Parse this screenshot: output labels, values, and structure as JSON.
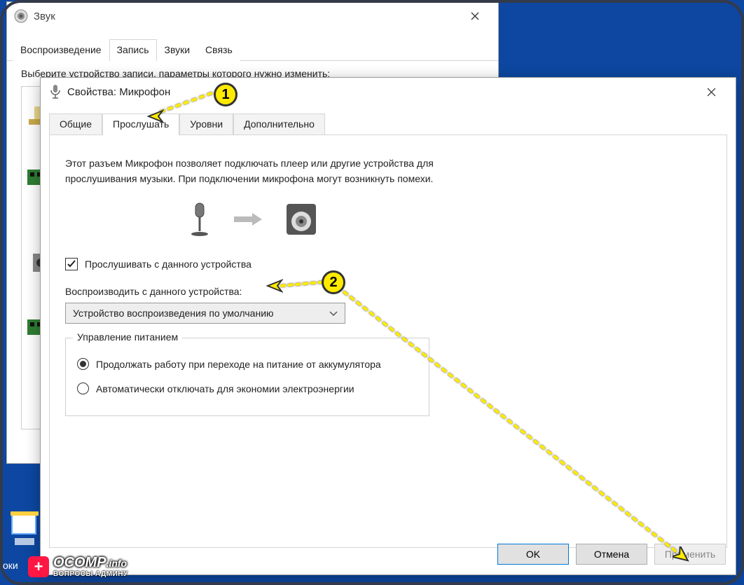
{
  "sound_window": {
    "title": "Звук",
    "tabs": [
      "Воспроизведение",
      "Запись",
      "Звуки",
      "Связь"
    ],
    "active_tab_index": 1,
    "instruction": "Выберите устройство записи, параметры которого нужно изменить:"
  },
  "prop_window": {
    "title": "Свойства: Микрофон",
    "tabs": [
      "Общие",
      "Прослушать",
      "Уровни",
      "Дополнительно"
    ],
    "active_tab_index": 1,
    "description": "Этот разъем Микрофон позволяет подключать плеер или другие устройства для прослушивания музыки. При подключении микрофона могут возникнуть помехи.",
    "checkbox_label": "Прослушивать с данного устройства",
    "checkbox_checked": true,
    "playback_label": "Воспроизводить с данного устройства:",
    "playback_value": "Устройство воспроизведения по умолчанию",
    "power_group_title": "Управление питанием",
    "radio1": "Продолжать работу при переходе на питание от аккумулятора",
    "radio2": "Автоматически отключать для экономии электроэнергии",
    "radio_selected": 0,
    "buttons": {
      "ok": "OK",
      "cancel": "Отмена",
      "apply": "Применить"
    }
  },
  "markers": {
    "m1": "1",
    "m2": "2"
  },
  "watermark": {
    "main": "OCOMP",
    "suffix": ".info",
    "sub": "ВОПРОСЫ АДМИНУ"
  },
  "taskbar": {
    "label": "оки"
  }
}
